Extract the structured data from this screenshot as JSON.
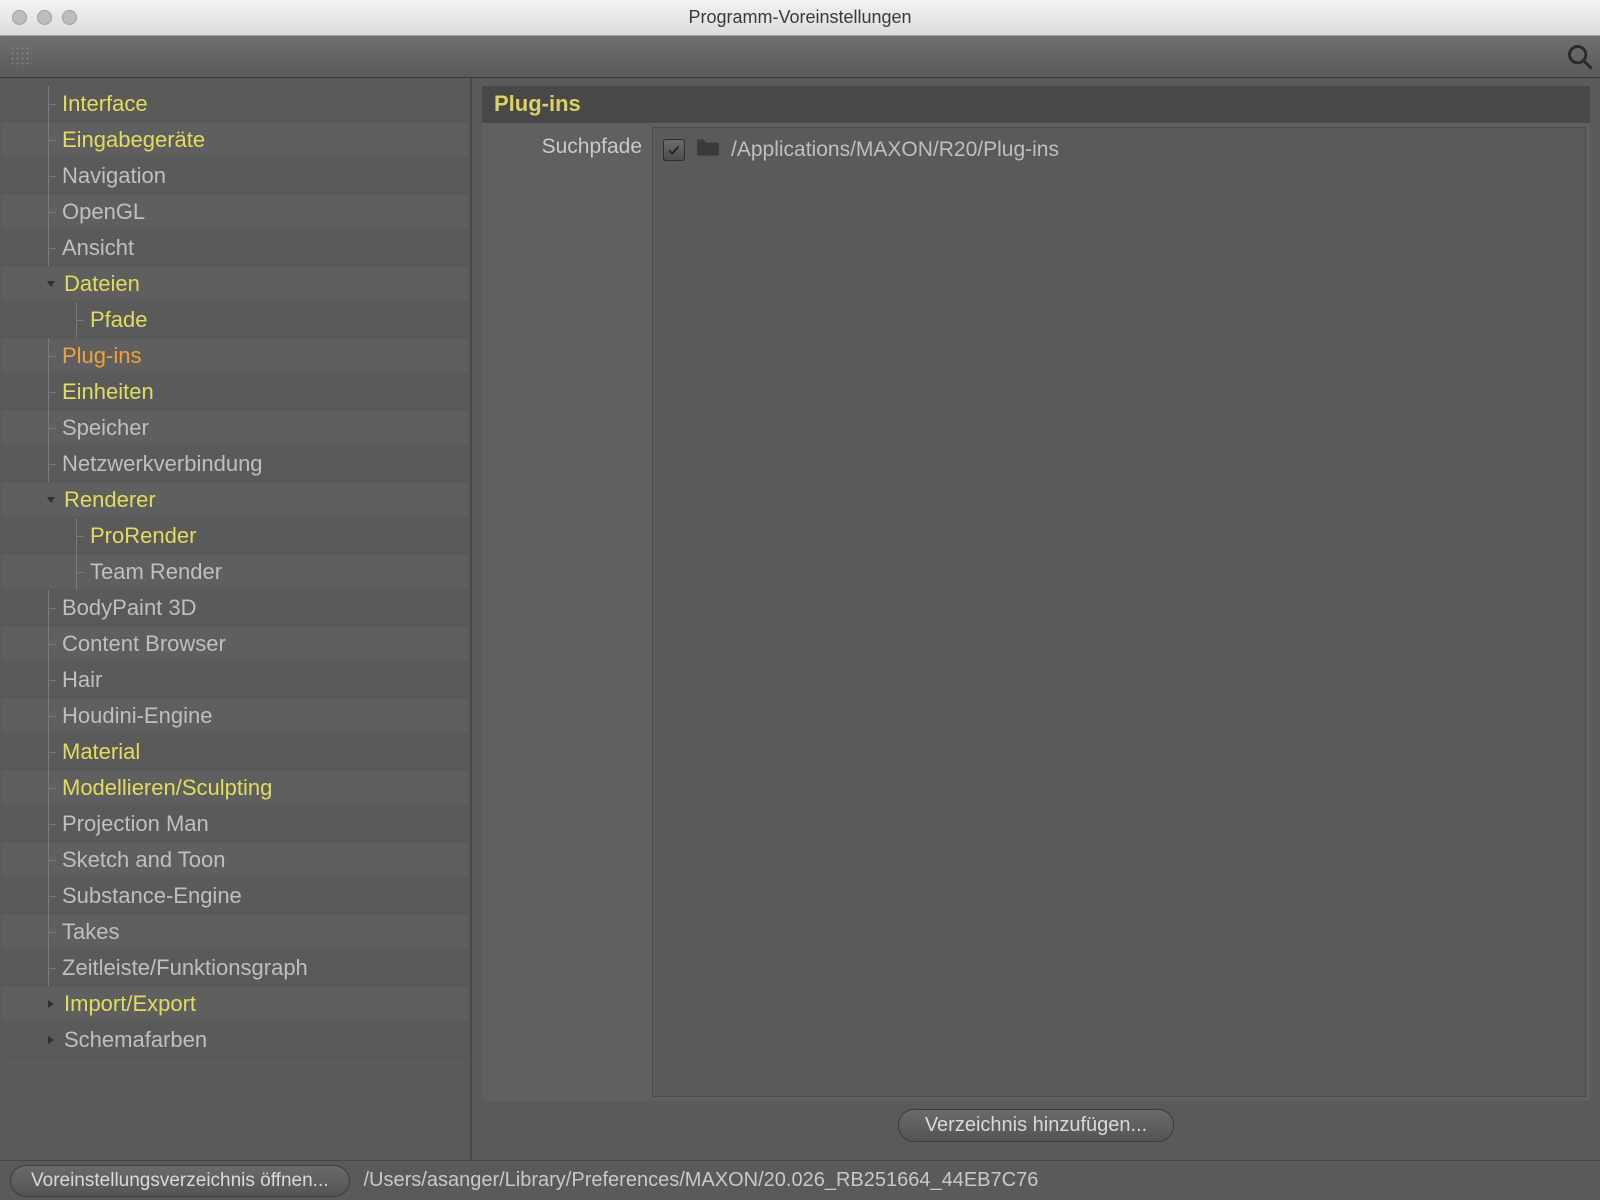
{
  "window": {
    "title": "Programm-Voreinstellungen"
  },
  "sidebar": {
    "items": [
      {
        "label": "Interface",
        "style": "highlight",
        "depth": 1,
        "arrow": "none",
        "tick": true
      },
      {
        "label": "Eingabegeräte",
        "style": "highlight",
        "depth": 1,
        "arrow": "none",
        "tick": true
      },
      {
        "label": "Navigation",
        "style": "normal",
        "depth": 1,
        "arrow": "none",
        "tick": true
      },
      {
        "label": "OpenGL",
        "style": "normal",
        "depth": 1,
        "arrow": "none",
        "tick": true
      },
      {
        "label": "Ansicht",
        "style": "normal",
        "depth": 1,
        "arrow": "none",
        "tick": true
      },
      {
        "label": "Dateien",
        "style": "highlight",
        "depth": 1,
        "arrow": "down",
        "tick": false
      },
      {
        "label": "Pfade",
        "style": "highlight",
        "depth": 2,
        "arrow": "none",
        "tick": true
      },
      {
        "label": "Plug-ins",
        "style": "selected",
        "depth": 1,
        "arrow": "none",
        "tick": true
      },
      {
        "label": "Einheiten",
        "style": "highlight",
        "depth": 1,
        "arrow": "none",
        "tick": true
      },
      {
        "label": "Speicher",
        "style": "normal",
        "depth": 1,
        "arrow": "none",
        "tick": true
      },
      {
        "label": "Netzwerkverbindung",
        "style": "normal",
        "depth": 1,
        "arrow": "none",
        "tick": true
      },
      {
        "label": "Renderer",
        "style": "highlight",
        "depth": 1,
        "arrow": "down",
        "tick": false
      },
      {
        "label": "ProRender",
        "style": "highlight",
        "depth": 2,
        "arrow": "none",
        "tick": true
      },
      {
        "label": "Team Render",
        "style": "normal",
        "depth": 2,
        "arrow": "none",
        "tick": true
      },
      {
        "label": "BodyPaint 3D",
        "style": "normal",
        "depth": 1,
        "arrow": "none",
        "tick": true
      },
      {
        "label": "Content Browser",
        "style": "normal",
        "depth": 1,
        "arrow": "none",
        "tick": true
      },
      {
        "label": "Hair",
        "style": "normal",
        "depth": 1,
        "arrow": "none",
        "tick": true
      },
      {
        "label": "Houdini-Engine",
        "style": "normal",
        "depth": 1,
        "arrow": "none",
        "tick": true
      },
      {
        "label": "Material",
        "style": "highlight",
        "depth": 1,
        "arrow": "none",
        "tick": true
      },
      {
        "label": "Modellieren/Sculpting",
        "style": "highlight",
        "depth": 1,
        "arrow": "none",
        "tick": true
      },
      {
        "label": "Projection Man",
        "style": "normal",
        "depth": 1,
        "arrow": "none",
        "tick": true
      },
      {
        "label": "Sketch and Toon",
        "style": "normal",
        "depth": 1,
        "arrow": "none",
        "tick": true
      },
      {
        "label": "Substance-Engine",
        "style": "normal",
        "depth": 1,
        "arrow": "none",
        "tick": true
      },
      {
        "label": "Takes",
        "style": "normal",
        "depth": 1,
        "arrow": "none",
        "tick": true
      },
      {
        "label": "Zeitleiste/Funktionsgraph",
        "style": "normal",
        "depth": 1,
        "arrow": "none",
        "tick": true
      },
      {
        "label": "Import/Export",
        "style": "highlight",
        "depth": 1,
        "arrow": "right",
        "tick": false
      },
      {
        "label": "Schemafarben",
        "style": "normal",
        "depth": 1,
        "arrow": "right",
        "tick": false
      }
    ]
  },
  "detail": {
    "section_title": "Plug-ins",
    "param_label": "Suchpfade",
    "path_checked": true,
    "path_value": "/Applications/MAXON/R20/Plug-ins",
    "add_button": "Verzeichnis hinzufügen..."
  },
  "footer": {
    "open_button": "Voreinstellungsverzeichnis öffnen...",
    "path": "/Users/asanger/Library/Preferences/MAXON/20.026_RB251664_44EB7C76"
  }
}
